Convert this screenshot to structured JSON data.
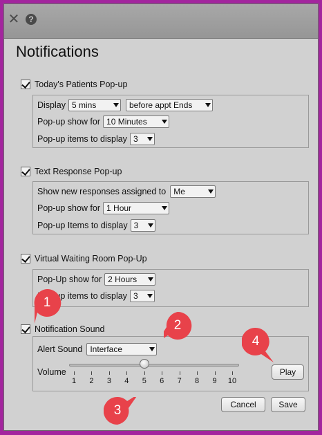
{
  "window": {
    "close_icon": "close-icon",
    "help_icon": "help-icon"
  },
  "title": "Notifications",
  "todays_patients": {
    "label": "Today's Patients Pop-up",
    "checked": true,
    "display_label": "Display",
    "display_value": "5 mins",
    "display_when": "before appt Ends",
    "show_for_label": "Pop-up show for",
    "show_for_value": "10 Minutes",
    "items_label": "Pop-up items to display",
    "items_value": "3"
  },
  "text_response": {
    "label": "Text Response Pop-up",
    "checked": true,
    "assigned_label": "Show new responses assigned to",
    "assigned_value": "Me",
    "show_for_label": "Pop-up show for",
    "show_for_value": "1 Hour",
    "items_label": "Pop-up Items to display",
    "items_value": "3"
  },
  "virtual_waiting": {
    "label": "Virtual Waiting Room Pop-Up",
    "checked": true,
    "show_for_label": "Pop-Up show for",
    "show_for_value": "2 Hours",
    "items_label": "Pop-up items to display",
    "items_value": "3"
  },
  "notification_sound": {
    "label": "Notification Sound",
    "checked": true,
    "alert_label": "Alert Sound",
    "alert_value": "Interface",
    "volume_label": "Volume",
    "volume_value": 5,
    "volume_ticks": [
      "1",
      "2",
      "3",
      "4",
      "5",
      "6",
      "7",
      "8",
      "9",
      "10"
    ],
    "play_label": "Play"
  },
  "footer": {
    "cancel_label": "Cancel",
    "save_label": "Save"
  },
  "annotations": {
    "marker_1": "1",
    "marker_2": "2",
    "marker_3": "3",
    "marker_4": "4",
    "color": "#e8424a"
  }
}
